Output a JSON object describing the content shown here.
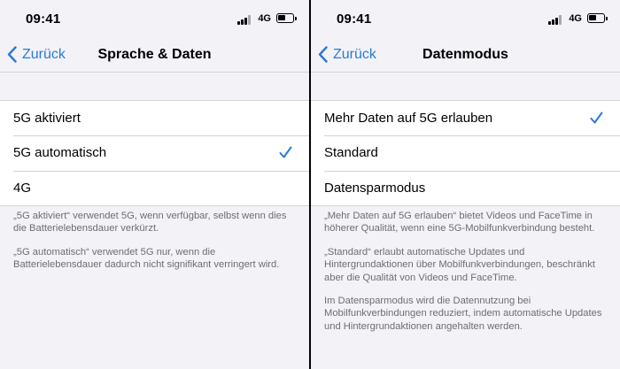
{
  "left": {
    "status": {
      "time": "09:41",
      "network": "4G"
    },
    "nav": {
      "back_label": "Zurück",
      "title": "Sprache & Daten"
    },
    "options": [
      {
        "label": "5G aktiviert",
        "selected": false
      },
      {
        "label": "5G automatisch",
        "selected": true
      },
      {
        "label": "4G",
        "selected": false
      }
    ],
    "footer": [
      "„5G aktiviert“ verwendet 5G, wenn verfügbar, selbst wenn dies die Batterielebensdauer verkürzt.",
      "„5G automatisch“ verwendet 5G nur, wenn die Batterielebensdauer dadurch nicht signifikant verringert wird."
    ]
  },
  "right": {
    "status": {
      "time": "09:41",
      "network": "4G"
    },
    "nav": {
      "back_label": "Zurück",
      "title": "Datenmodus"
    },
    "options": [
      {
        "label": "Mehr Daten auf 5G erlauben",
        "selected": true
      },
      {
        "label": "Standard",
        "selected": false
      },
      {
        "label": "Datensparmodus",
        "selected": false
      }
    ],
    "footer": [
      "„Mehr Daten auf 5G erlauben“ bietet Videos und FaceTime in höherer Qualität, wenn eine 5G-Mobilfunkverbindung besteht.",
      "„Standard“ erlaubt automatische Updates und Hintergrundaktionen über Mobilfunkverbindungen, beschränkt aber die Qualität von Videos und FaceTime.",
      "Im Datensparmodus wird die Datennutzung bei Mobilfunkverbindungen reduziert, indem automatische Updates und Hintergrundaktionen angehalten werden."
    ]
  },
  "colors": {
    "accent": "#2a79d8",
    "background": "#f2f2f7",
    "separator": "#d4d4d8",
    "footer_text": "#6d6d72"
  },
  "icons": {
    "back": "chevron-left-icon",
    "check": "checkmark-icon"
  }
}
